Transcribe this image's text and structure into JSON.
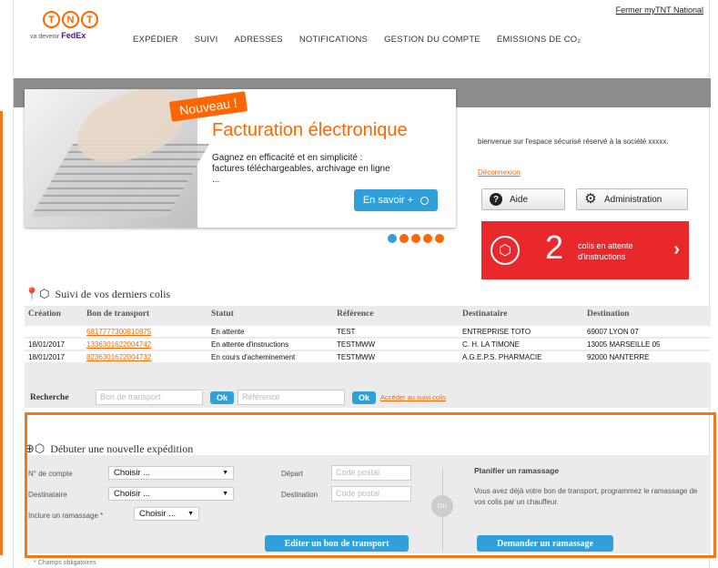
{
  "header": {
    "top_link": "Fermer myTNT National",
    "logo_letters": [
      "T",
      "N",
      "T"
    ],
    "logo_sub_prefix": "va devenir",
    "logo_sub_brand": "FedEx",
    "nav": [
      "EXPÉDIER",
      "SUIVI",
      "ADRESSES",
      "NOTIFICATIONS",
      "GESTION DU COMPTE",
      "ÉMISSIONS DE CO₂"
    ]
  },
  "banner": {
    "badge": "Nouveau !",
    "title": "Facturation électronique",
    "text": "Gagnez en efficacité et en simplicité : factures téléchargeables, archivage en ligne ...",
    "button": "En savoir +",
    "dots_count": 5,
    "active_dot": 0
  },
  "account": {
    "welcome": "bienvenue sur l'espace sécurisé réservé à la société xxxxx.",
    "logout": "Déconnexion",
    "help_button": "Aide",
    "admin_button": "Administration",
    "pending_count": "2",
    "pending_label": "colis en attente d'instructions",
    "colors": {
      "accent": "#ff6600",
      "alert": "#e8282b",
      "blue": "#2fa0da"
    }
  },
  "tracking": {
    "title": "Suivi de vos derniers colis",
    "columns": [
      "Création",
      "Bon de transport",
      "Statut",
      "Référence",
      "Destinataire",
      "Destination"
    ],
    "rows": [
      [
        "",
        "6817777300810875",
        "En attente",
        "TEST",
        "ENTREPRISE TOTO",
        "69007 LYON 07"
      ],
      [
        "18/01/2017",
        "1336301622004742",
        "En attente d'instructions",
        "TESTMWW",
        "C. H. LA TIMONE",
        "13005 MARSEILLE 05"
      ],
      [
        "18/01/2017",
        "8236301622004732",
        "En cours d'acheminement",
        "TESTMWW",
        "A.G.E.P.S. PHARMACIE",
        "92000 NANTERRE"
      ]
    ],
    "search_label": "Recherche",
    "search_placeholder_1": "Bon de transport",
    "ok_1": "Ok",
    "search_placeholder_2": "Référence",
    "ok_2": "Ok",
    "access_link": "Accéder au suivi colis"
  },
  "expedition": {
    "title": "Débuter une nouvelle expédition",
    "account_label": "N° de compte",
    "account_value": "Choisir ...",
    "recipient_label": "Destinataire",
    "recipient_value": "Choisir ...",
    "pickup_label": "Inclure un ramassage *",
    "pickup_value": "Choisir ...",
    "depart_label": "Départ",
    "depart_placeholder": "Code postal",
    "destination_label": "Destination",
    "destination_placeholder": "Code postal",
    "or_label": "OU",
    "plan_title": "Planifier un ramassage",
    "plan_text": "Vous avez déjà votre bon de transport, programmez le ramassage de vos colis par un chauffeur.",
    "edit_button": "Editer un bon de transport",
    "request_button": "Demander un ramassage",
    "footnote": "* Champs obligatoires"
  }
}
